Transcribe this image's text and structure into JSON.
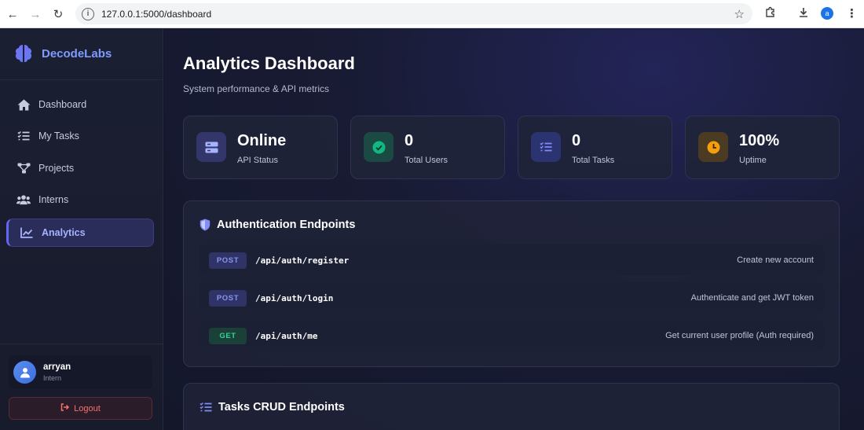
{
  "browser": {
    "url": "127.0.0.1:5000/dashboard",
    "profile_initial": "a"
  },
  "sidebar": {
    "brand": "DecodeLabs",
    "items": [
      {
        "label": "Dashboard",
        "icon": "home-icon",
        "active": false
      },
      {
        "label": "My Tasks",
        "icon": "tasks-icon",
        "active": false
      },
      {
        "label": "Projects",
        "icon": "projects-icon",
        "active": false
      },
      {
        "label": "Interns",
        "icon": "users-icon",
        "active": false
      },
      {
        "label": "Analytics",
        "icon": "chart-line-icon",
        "active": true
      }
    ],
    "user": {
      "name": "arryan",
      "role": "Intern"
    },
    "logout_label": "Logout"
  },
  "main": {
    "title": "Analytics Dashboard",
    "subtitle": "System performance & API metrics",
    "stats": [
      {
        "value": "Online",
        "label": "API Status",
        "icon": "server-icon",
        "color": "#818cf8"
      },
      {
        "value": "0",
        "label": "Total Users",
        "icon": "check-circle-icon",
        "color": "#10b981"
      },
      {
        "value": "0",
        "label": "Total Tasks",
        "icon": "tasks-icon",
        "color": "#6366f1"
      },
      {
        "value": "100%",
        "label": "Uptime",
        "icon": "clock-icon",
        "color": "#f59e0b"
      }
    ],
    "auth_panel": {
      "title": "Authentication Endpoints",
      "icon": "shield-icon",
      "endpoints": [
        {
          "method": "POST",
          "path": "/api/auth/register",
          "desc": "Create new account"
        },
        {
          "method": "POST",
          "path": "/api/auth/login",
          "desc": "Authenticate and get JWT token"
        },
        {
          "method": "GET",
          "path": "/api/auth/me",
          "desc": "Get current user profile (Auth required)"
        }
      ]
    },
    "tasks_panel": {
      "title": "Tasks CRUD Endpoints",
      "icon": "tasks-icon"
    }
  }
}
